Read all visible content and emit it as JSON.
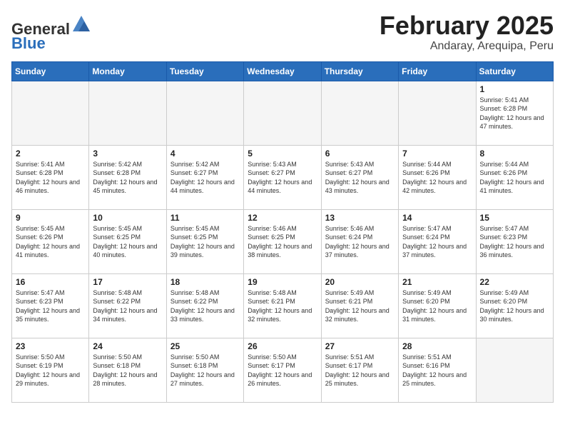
{
  "header": {
    "logo_general": "General",
    "logo_blue": "Blue",
    "month_title": "February 2025",
    "location": "Andaray, Arequipa, Peru"
  },
  "days_of_week": [
    "Sunday",
    "Monday",
    "Tuesday",
    "Wednesday",
    "Thursday",
    "Friday",
    "Saturday"
  ],
  "weeks": [
    [
      {
        "day": "",
        "info": ""
      },
      {
        "day": "",
        "info": ""
      },
      {
        "day": "",
        "info": ""
      },
      {
        "day": "",
        "info": ""
      },
      {
        "day": "",
        "info": ""
      },
      {
        "day": "",
        "info": ""
      },
      {
        "day": "1",
        "info": "Sunrise: 5:41 AM\nSunset: 6:28 PM\nDaylight: 12 hours and 47 minutes."
      }
    ],
    [
      {
        "day": "2",
        "info": "Sunrise: 5:41 AM\nSunset: 6:28 PM\nDaylight: 12 hours and 46 minutes."
      },
      {
        "day": "3",
        "info": "Sunrise: 5:42 AM\nSunset: 6:28 PM\nDaylight: 12 hours and 45 minutes."
      },
      {
        "day": "4",
        "info": "Sunrise: 5:42 AM\nSunset: 6:27 PM\nDaylight: 12 hours and 44 minutes."
      },
      {
        "day": "5",
        "info": "Sunrise: 5:43 AM\nSunset: 6:27 PM\nDaylight: 12 hours and 44 minutes."
      },
      {
        "day": "6",
        "info": "Sunrise: 5:43 AM\nSunset: 6:27 PM\nDaylight: 12 hours and 43 minutes."
      },
      {
        "day": "7",
        "info": "Sunrise: 5:44 AM\nSunset: 6:26 PM\nDaylight: 12 hours and 42 minutes."
      },
      {
        "day": "8",
        "info": "Sunrise: 5:44 AM\nSunset: 6:26 PM\nDaylight: 12 hours and 41 minutes."
      }
    ],
    [
      {
        "day": "9",
        "info": "Sunrise: 5:45 AM\nSunset: 6:26 PM\nDaylight: 12 hours and 41 minutes."
      },
      {
        "day": "10",
        "info": "Sunrise: 5:45 AM\nSunset: 6:25 PM\nDaylight: 12 hours and 40 minutes."
      },
      {
        "day": "11",
        "info": "Sunrise: 5:45 AM\nSunset: 6:25 PM\nDaylight: 12 hours and 39 minutes."
      },
      {
        "day": "12",
        "info": "Sunrise: 5:46 AM\nSunset: 6:25 PM\nDaylight: 12 hours and 38 minutes."
      },
      {
        "day": "13",
        "info": "Sunrise: 5:46 AM\nSunset: 6:24 PM\nDaylight: 12 hours and 37 minutes."
      },
      {
        "day": "14",
        "info": "Sunrise: 5:47 AM\nSunset: 6:24 PM\nDaylight: 12 hours and 37 minutes."
      },
      {
        "day": "15",
        "info": "Sunrise: 5:47 AM\nSunset: 6:23 PM\nDaylight: 12 hours and 36 minutes."
      }
    ],
    [
      {
        "day": "16",
        "info": "Sunrise: 5:47 AM\nSunset: 6:23 PM\nDaylight: 12 hours and 35 minutes."
      },
      {
        "day": "17",
        "info": "Sunrise: 5:48 AM\nSunset: 6:22 PM\nDaylight: 12 hours and 34 minutes."
      },
      {
        "day": "18",
        "info": "Sunrise: 5:48 AM\nSunset: 6:22 PM\nDaylight: 12 hours and 33 minutes."
      },
      {
        "day": "19",
        "info": "Sunrise: 5:48 AM\nSunset: 6:21 PM\nDaylight: 12 hours and 32 minutes."
      },
      {
        "day": "20",
        "info": "Sunrise: 5:49 AM\nSunset: 6:21 PM\nDaylight: 12 hours and 32 minutes."
      },
      {
        "day": "21",
        "info": "Sunrise: 5:49 AM\nSunset: 6:20 PM\nDaylight: 12 hours and 31 minutes."
      },
      {
        "day": "22",
        "info": "Sunrise: 5:49 AM\nSunset: 6:20 PM\nDaylight: 12 hours and 30 minutes."
      }
    ],
    [
      {
        "day": "23",
        "info": "Sunrise: 5:50 AM\nSunset: 6:19 PM\nDaylight: 12 hours and 29 minutes."
      },
      {
        "day": "24",
        "info": "Sunrise: 5:50 AM\nSunset: 6:18 PM\nDaylight: 12 hours and 28 minutes."
      },
      {
        "day": "25",
        "info": "Sunrise: 5:50 AM\nSunset: 6:18 PM\nDaylight: 12 hours and 27 minutes."
      },
      {
        "day": "26",
        "info": "Sunrise: 5:50 AM\nSunset: 6:17 PM\nDaylight: 12 hours and 26 minutes."
      },
      {
        "day": "27",
        "info": "Sunrise: 5:51 AM\nSunset: 6:17 PM\nDaylight: 12 hours and 25 minutes."
      },
      {
        "day": "28",
        "info": "Sunrise: 5:51 AM\nSunset: 6:16 PM\nDaylight: 12 hours and 25 minutes."
      },
      {
        "day": "",
        "info": ""
      }
    ]
  ]
}
